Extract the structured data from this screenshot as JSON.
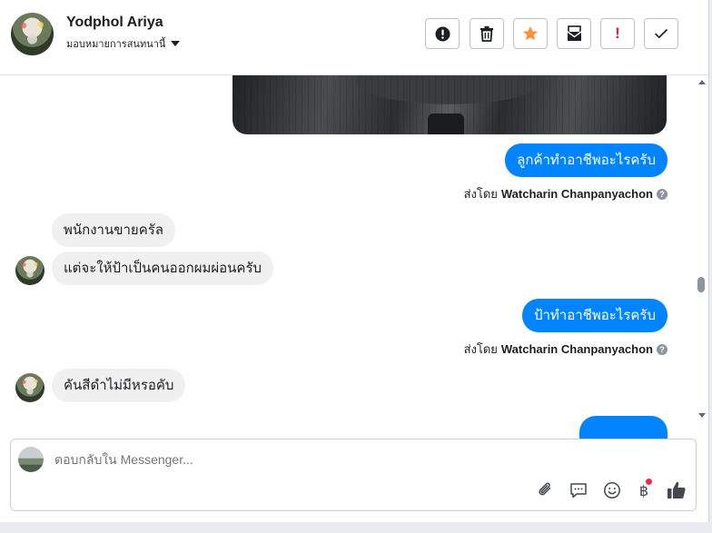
{
  "header": {
    "name": "Yodphol Ariya",
    "assignee": "มอบหมายการสนทนานี้"
  },
  "toolbar": {
    "buttons": [
      "alert-icon",
      "trash-icon",
      "star-icon",
      "move-to-inbox-icon",
      "mark-important-icon",
      "check-icon"
    ],
    "important_label": "!"
  },
  "messages": {
    "m1": {
      "text": "ลูกค้าทำอาชีพอะไรครับ",
      "sent_by_prefix": "ส่งโดย",
      "sent_by_name": "Watcharin Chanpanyachon"
    },
    "m2": {
      "text": "พนักงานขายครัล"
    },
    "m3": {
      "text": "แต่จะให้ป้าเป็นคนออกผมผ่อนครับ"
    },
    "m4": {
      "text": "ป้าทำอาชีพอะไรครับ",
      "sent_by_prefix": "ส่งโดย",
      "sent_by_name": "Watcharin Chanpanyachon"
    },
    "m5": {
      "text": "คันสีดำไม่มีหรอคับ"
    }
  },
  "composer": {
    "placeholder": "ตอบกลับใน Messenger...",
    "icons": [
      "paperclip-icon",
      "saved-reply-icon",
      "emoji-icon",
      "baht-payment-icon",
      "thumbs-up-icon"
    ],
    "baht_symbol": "฿"
  },
  "colors": {
    "outgoing_bubble": "#0084ff",
    "incoming_bubble": "#f0f0f0",
    "star": "#f7923b",
    "important": "#e41e3f",
    "notification_dot": "#f02849"
  }
}
